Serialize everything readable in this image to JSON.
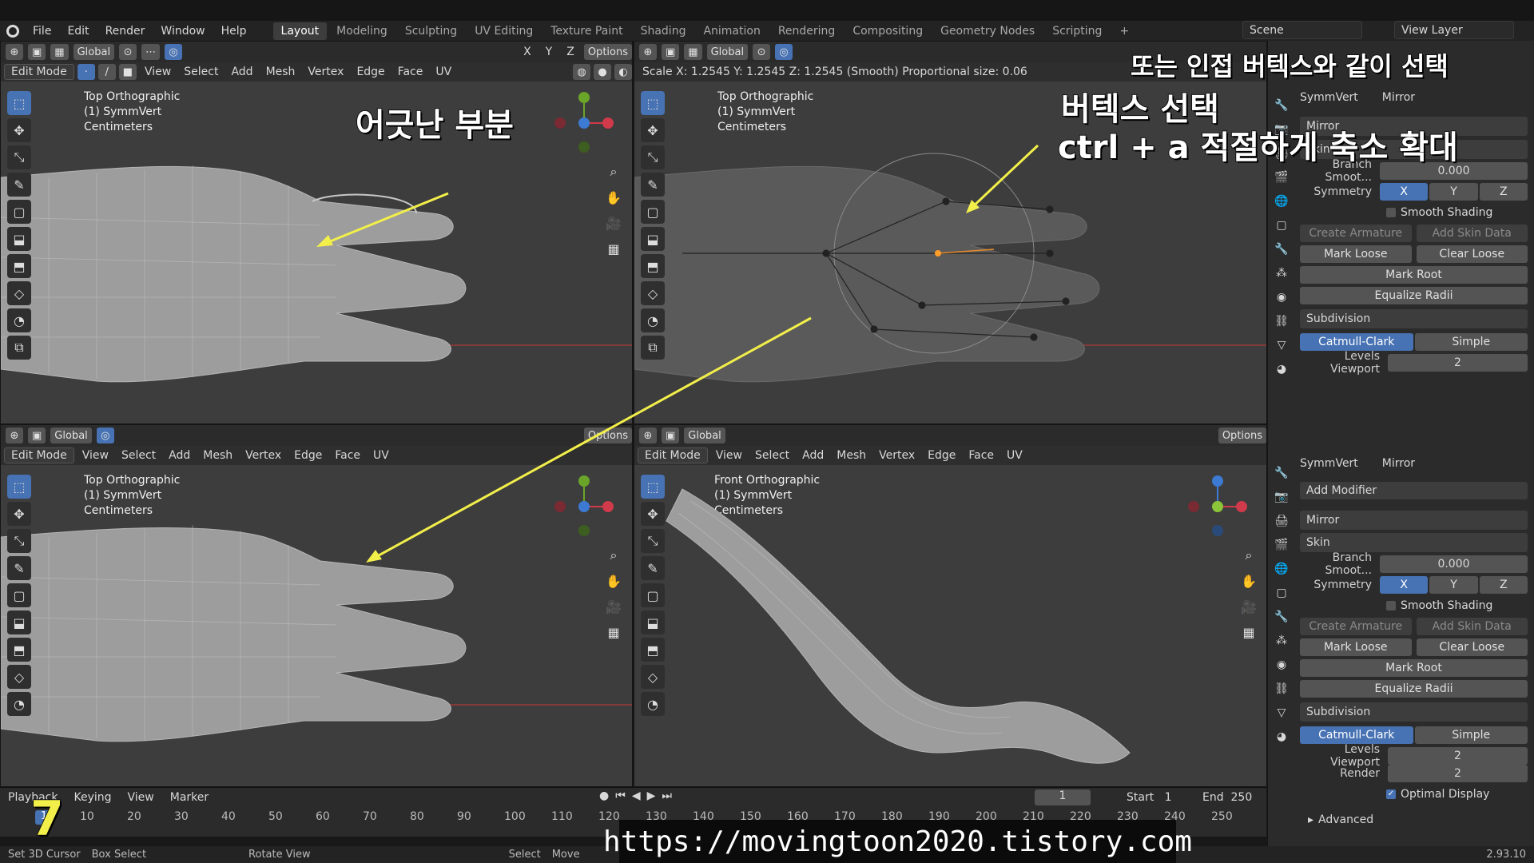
{
  "menubar": {
    "items": [
      "File",
      "Edit",
      "Render",
      "Window",
      "Help"
    ],
    "workspaces": [
      "Layout",
      "Modeling",
      "Sculpting",
      "UV Editing",
      "Texture Paint",
      "Shading",
      "Animation",
      "Rendering",
      "Compositing",
      "Geometry Nodes",
      "Scripting"
    ],
    "active_workspace": "Layout",
    "scene": "Scene",
    "view_layer": "View Layer"
  },
  "viewport_header": {
    "mode": "Edit Mode",
    "menus": [
      "View",
      "Select",
      "Add",
      "Mesh",
      "Vertex",
      "Edge",
      "Face",
      "UV"
    ],
    "orientation": "Global",
    "options": "Options",
    "axes": [
      "X",
      "Y",
      "Z"
    ]
  },
  "viewports": {
    "tl": {
      "view": "Top Orthographic",
      "object": "(1) SymmVert",
      "units": "Centimeters"
    },
    "tr": {
      "view": "Top Orthographic",
      "object": "(1) SymmVert",
      "units": "Centimeters",
      "status": "Scale X: 1.2545   Y: 1.2545   Z: 1.2545 (Smooth) Proportional size: 0.06"
    },
    "bl": {
      "view": "Top Orthographic",
      "object": "(1) SymmVert",
      "units": "Centimeters"
    },
    "br": {
      "view": "Front Orthographic",
      "object": "(1) SymmVert",
      "units": "Centimeters"
    }
  },
  "properties": {
    "object": "SymmVert",
    "modifier_name": "Mirror",
    "add_modifier": "Add Modifier",
    "mirror": "Mirror",
    "skin": "Skin",
    "branch_smooth_label": "Branch Smoot...",
    "branch_smooth_value": "0.000",
    "symmetry_label": "Symmetry",
    "sym_x": "X",
    "sym_y": "Y",
    "sym_z": "Z",
    "smooth_shading": "Smooth Shading",
    "create_armature": "Create Armature",
    "add_skin_data": "Add Skin Data",
    "mark_loose": "Mark Loose",
    "clear_loose": "Clear Loose",
    "mark_root": "Mark Root",
    "equalize_radii": "Equalize Radii",
    "subdivision": "Subdivision",
    "catmull_clark": "Catmull-Clark",
    "simple": "Simple",
    "levels_viewport_label": "Levels Viewport",
    "levels_viewport_value": "2",
    "render_label": "Render",
    "render_value": "2",
    "optimal_display": "Optimal Display",
    "advanced": "Advanced"
  },
  "timeline": {
    "menus": [
      "Playback",
      "Keying",
      "View",
      "Marker"
    ],
    "current_frame": "1",
    "start_label": "Start",
    "start_value": "1",
    "end_label": "End",
    "end_value": "250",
    "ticks": [
      "10",
      "20",
      "30",
      "40",
      "50",
      "60",
      "70",
      "80",
      "90",
      "100",
      "110",
      "120",
      "130",
      "140",
      "150",
      "160",
      "170",
      "180",
      "190",
      "200",
      "210",
      "220",
      "230",
      "240",
      "250"
    ],
    "frame_marker": "1"
  },
  "statusbar": {
    "items": [
      "Set 3D Cursor",
      "Box Select",
      "Rotate View",
      "Select",
      "Move"
    ],
    "version": "2.93.10"
  },
  "annotations": {
    "misaligned": "어긋난 부분",
    "select_vertex": "버텍스 선택",
    "ctrl_a": "ctrl + a 적절하게 축소 확대",
    "or_adjacent": "또는 인접 버텍스와 같이 선택",
    "step": "7",
    "url": "https://movingtoon2020.tistory.com"
  },
  "colors": {
    "accent": "#4772b3",
    "viewport_bg": "#3d3d3d",
    "arrow": "#f2ef4a"
  }
}
